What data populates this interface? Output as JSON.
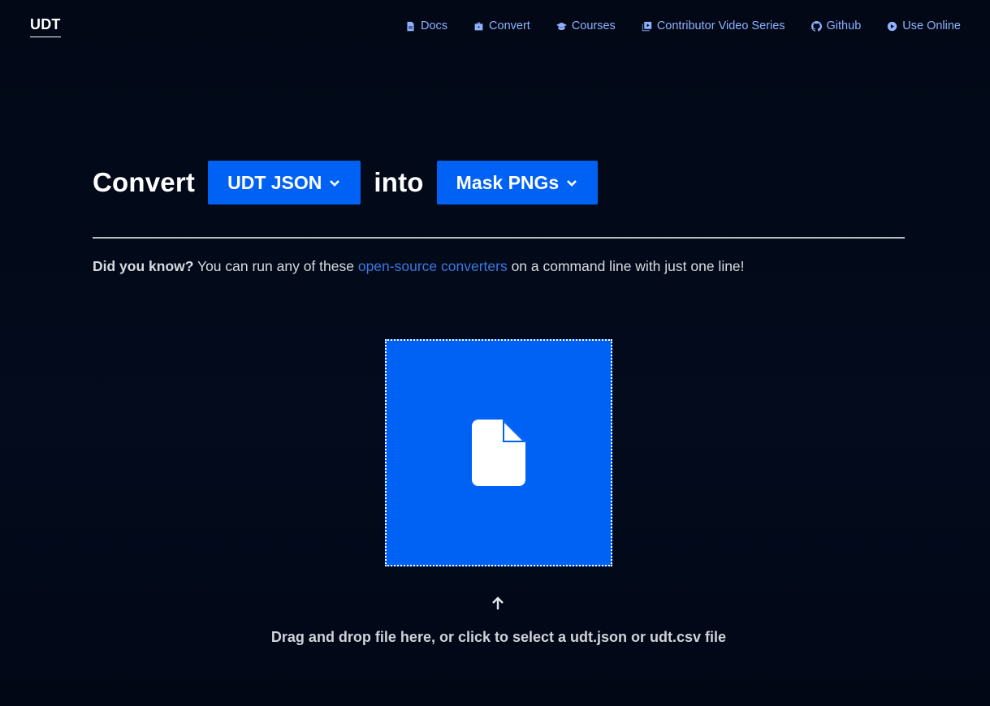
{
  "header": {
    "logo": "UDT",
    "nav": [
      {
        "label": "Docs",
        "icon": "document-icon"
      },
      {
        "label": "Convert",
        "icon": "briefcase-icon"
      },
      {
        "label": "Courses",
        "icon": "graduation-cap-icon"
      },
      {
        "label": "Contributor Video Series",
        "icon": "video-library-icon"
      },
      {
        "label": "Github",
        "icon": "github-icon"
      },
      {
        "label": "Use Online",
        "icon": "play-circle-icon"
      }
    ]
  },
  "converter": {
    "convert_label": "Convert",
    "from_format": "UDT JSON",
    "into_label": "into",
    "to_format": "Mask PNGs"
  },
  "tip": {
    "lead": "Did you know?",
    "before_link": " You can run any of these ",
    "link_text": "open-source converters",
    "after_link": " on a command line with just one line!"
  },
  "dropzone": {
    "icon": "file-icon",
    "arrow_icon": "arrow-up-icon",
    "instruction": "Drag and drop file here, or click to select a udt.json or udt.csv file"
  },
  "colors": {
    "background": "#030a1a",
    "accent": "#0062f5",
    "nav_link": "#8fb1ff",
    "link": "#3b78e0"
  }
}
